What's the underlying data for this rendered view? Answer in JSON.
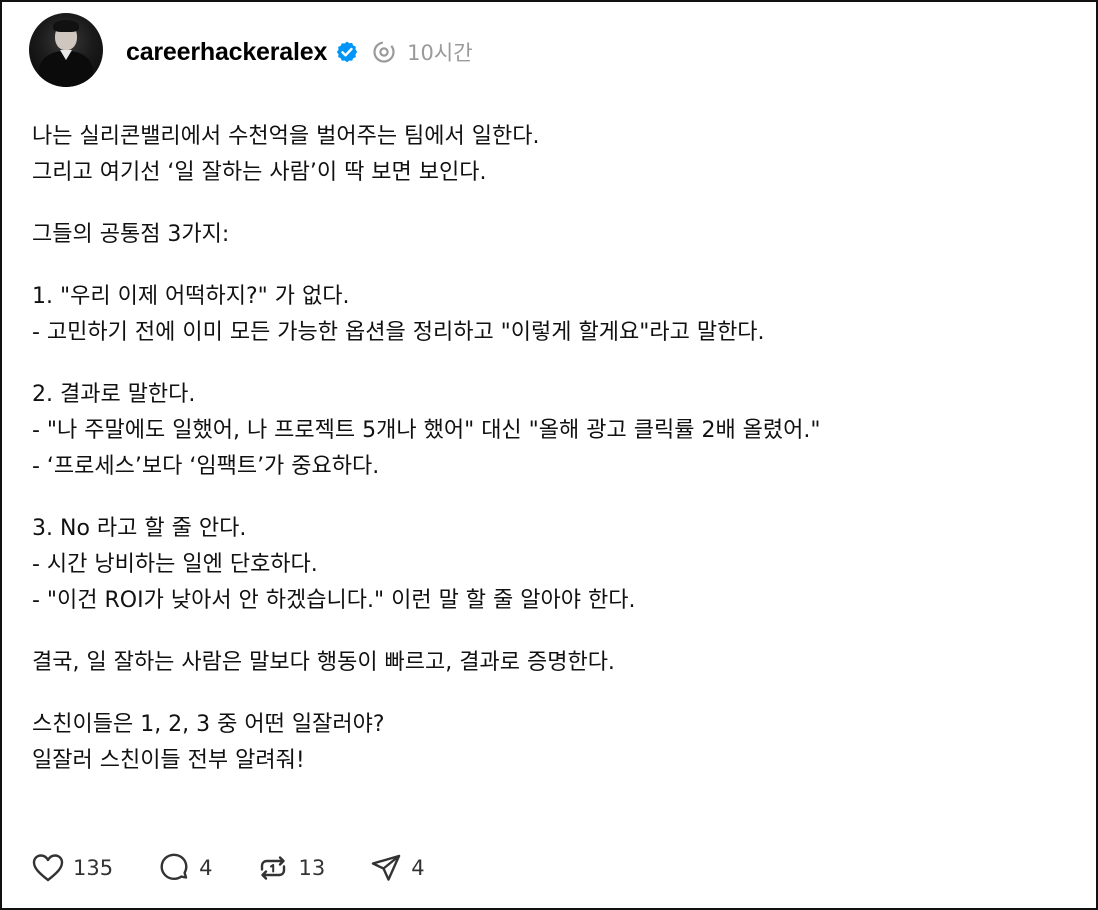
{
  "post": {
    "username": "careerhackeralex",
    "time": "10시간",
    "paragraphs": [
      "나는 실리콘밸리에서 수천억을 벌어주는 팀에서 일한다.\n그리고 여기선 ‘일 잘하는 사람’이 딱 보면 보인다.",
      "그들의 공통점 3가지:",
      "1. \"우리 이제 어떡하지?\" 가 없다.\n- 고민하기 전에 이미 모든 가능한 옵션을 정리하고 \"이렇게 할게요\"라고 말한다.",
      "2. 결과로 말한다.\n- \"나 주말에도 일했어, 나 프로젝트 5개나 했어\" 대신 \"올해 광고 클릭률 2배 올렸어.\"\n- ‘프로세스’보다 ‘임팩트’가 중요하다.",
      "3. No 라고 할 줄 안다.\n- 시간 낭비하는 일엔 단호하다.\n- \"이건 ROI가 낮아서 안 하겠습니다.\" 이런 말 할 줄 알아야 한다.",
      "결국, 일 잘하는 사람은 말보다 행동이 빠르고, 결과로 증명한다.",
      "스친이들은 1, 2, 3 중 어떤 일잘러야?\n일잘러 스친이들 전부 알려줘!"
    ]
  },
  "actions": {
    "likes": "135",
    "comments": "4",
    "reposts": "13",
    "shares": "4"
  },
  "icons": {
    "verified": "verified-badge-icon",
    "threads": "threads-logo-icon",
    "like": "heart-icon",
    "comment": "comment-bubble-icon",
    "repost": "repost-icon",
    "share": "send-icon"
  },
  "colors": {
    "verified": "#0095f6",
    "muted": "#9a9a9a"
  }
}
